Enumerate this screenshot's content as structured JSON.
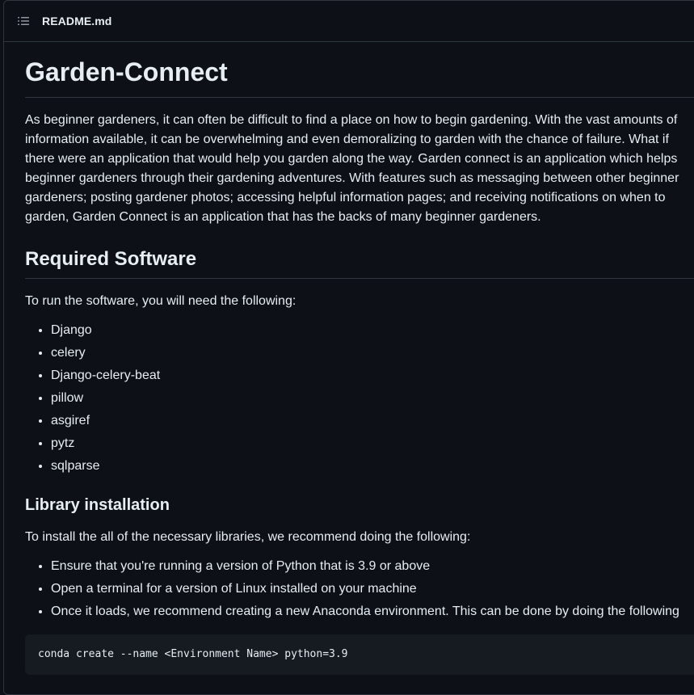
{
  "file_header": {
    "toc_icon": "list-unordered-icon",
    "file_name": "README.md"
  },
  "readme": {
    "title": "Garden-Connect",
    "intro": "As beginner gardeners, it can often be difficult to find a place on how to begin gardening. With the vast amounts of information available, it can be overwhelming and even demoralizing to garden with the chance of failure. What if there were an application that would help you garden along the way. Garden connect is an application which helps beginner gardeners through their gardening adventures. With features such as messaging between other beginner gardeners; posting gardener photos; accessing helpful information pages; and receiving notifications on when to garden, Garden Connect is an application that has the backs of many beginner gardeners.",
    "required_software": {
      "heading": "Required Software",
      "lead": "To run the software, you will need the following:",
      "items": [
        "Django",
        "celery",
        "Django-celery-beat",
        "pillow",
        "asgiref",
        "pytz",
        "sqlparse"
      ]
    },
    "library_installation": {
      "heading": "Library installation",
      "lead": "To install the all of the necessary libraries, we recommend doing the following:",
      "items": [
        "Ensure that you're running a version of Python that is 3.9 or above",
        "Open a terminal for a version of Linux installed on your machine",
        "Once it loads, we recommend creating a new Anaconda environment. This can be done by doing the following"
      ],
      "code": "conda create --name <Environment Name> python=3.9"
    }
  },
  "colors": {
    "background": "#0d1117",
    "border": "#30363d",
    "text": "#e6edf3",
    "code_bg": "#161b22"
  }
}
